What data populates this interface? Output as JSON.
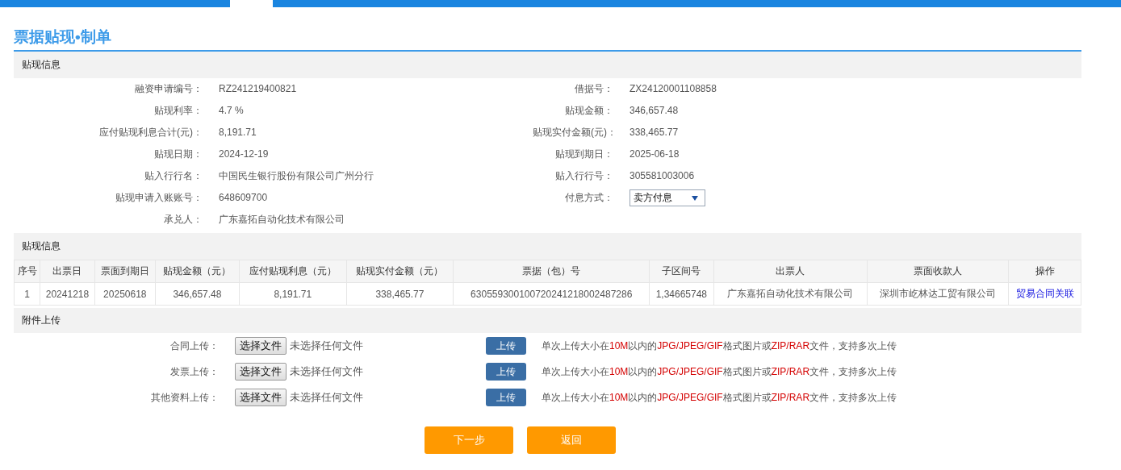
{
  "title": "票据贴现•制单",
  "info_section": {
    "heading": "贴现信息",
    "fields": [
      {
        "label": "融资申请编号：",
        "value": "RZ241219400821",
        "kind": "text"
      },
      {
        "label": "借据号：",
        "value": "ZX24120001108858",
        "kind": "text"
      },
      {
        "label": "贴现利率：",
        "value": "4.7 %",
        "kind": "text"
      },
      {
        "label": "贴现金额：",
        "value": "346,657.48",
        "kind": "text"
      },
      {
        "label": "应付贴现利息合计(元)：",
        "value": "8,191.71",
        "kind": "text"
      },
      {
        "label": "贴现实付金额(元)：",
        "value": "338,465.77",
        "kind": "text"
      },
      {
        "label": "贴现日期：",
        "value": "2024-12-19",
        "kind": "text"
      },
      {
        "label": "贴现到期日：",
        "value": "2025-06-18",
        "kind": "text"
      },
      {
        "label": "贴入行行名：",
        "value": "中国民生银行股份有限公司广州分行",
        "kind": "text"
      },
      {
        "label": "贴入行行号：",
        "value": "305581003006",
        "kind": "text"
      },
      {
        "label": "贴现申请入账账号：",
        "value": "648609700",
        "kind": "text"
      },
      {
        "label": "付息方式：",
        "value": "卖方付息",
        "kind": "select"
      },
      {
        "label": "承兑人：",
        "value": "广东嘉拓自动化技术有限公司",
        "kind": "text"
      }
    ]
  },
  "bill_section": {
    "heading": "贴现信息",
    "table": {
      "columns": [
        "序号",
        "出票日",
        "票面到期日",
        "贴现金额（元）",
        "应付贴现利息（元）",
        "贴现实付金额（元）",
        "票据（包）号",
        "子区间号",
        "出票人",
        "票面收款人",
        "操作"
      ],
      "rows": [
        {
          "cells": [
            "1",
            "20241218",
            "20250618",
            "346,657.48",
            "8,191.71",
            "338,465.77",
            "630559300100720241218002487286",
            "1,34665748",
            "广东嘉拓自动化技术有限公司",
            "深圳市屹林达工贸有限公司"
          ],
          "action": "贸易合同关联"
        }
      ]
    }
  },
  "upload_section": {
    "heading": "附件上传",
    "rows": [
      {
        "label": "合同上传：",
        "choose_button": "选择文件",
        "file_status": "未选择任何文件",
        "upload_button": "上传",
        "hint": [
          {
            "text": "单次上传大小在",
            "highlight": false
          },
          {
            "text": "10M",
            "highlight": true
          },
          {
            "text": "以内的",
            "highlight": false
          },
          {
            "text": "JPG/JPEG/GIF",
            "highlight": true
          },
          {
            "text": "格式图片或",
            "highlight": false
          },
          {
            "text": "ZIP/RAR",
            "highlight": true
          },
          {
            "text": "文件，支持多次上传",
            "highlight": false
          }
        ]
      },
      {
        "label": "发票上传：",
        "choose_button": "选择文件",
        "file_status": "未选择任何文件",
        "upload_button": "上传",
        "hint": [
          {
            "text": "单次上传大小在",
            "highlight": false
          },
          {
            "text": "10M",
            "highlight": true
          },
          {
            "text": "以内的",
            "highlight": false
          },
          {
            "text": "JPG/JPEG/GIF",
            "highlight": true
          },
          {
            "text": "格式图片或",
            "highlight": false
          },
          {
            "text": "ZIP/RAR",
            "highlight": true
          },
          {
            "text": "文件，支持多次上传",
            "highlight": false
          }
        ]
      },
      {
        "label": "其他资料上传：",
        "choose_button": "选择文件",
        "file_status": "未选择任何文件",
        "upload_button": "上传",
        "hint": [
          {
            "text": "单次上传大小在",
            "highlight": false
          },
          {
            "text": "10M",
            "highlight": true
          },
          {
            "text": "以内的",
            "highlight": false
          },
          {
            "text": "JPG/JPEG/GIF",
            "highlight": true
          },
          {
            "text": "格式图片或",
            "highlight": false
          },
          {
            "text": "ZIP/RAR",
            "highlight": true
          },
          {
            "text": "文件，支持多次上传",
            "highlight": false
          }
        ]
      }
    ]
  },
  "buttons": [
    "下一步",
    "返回"
  ]
}
